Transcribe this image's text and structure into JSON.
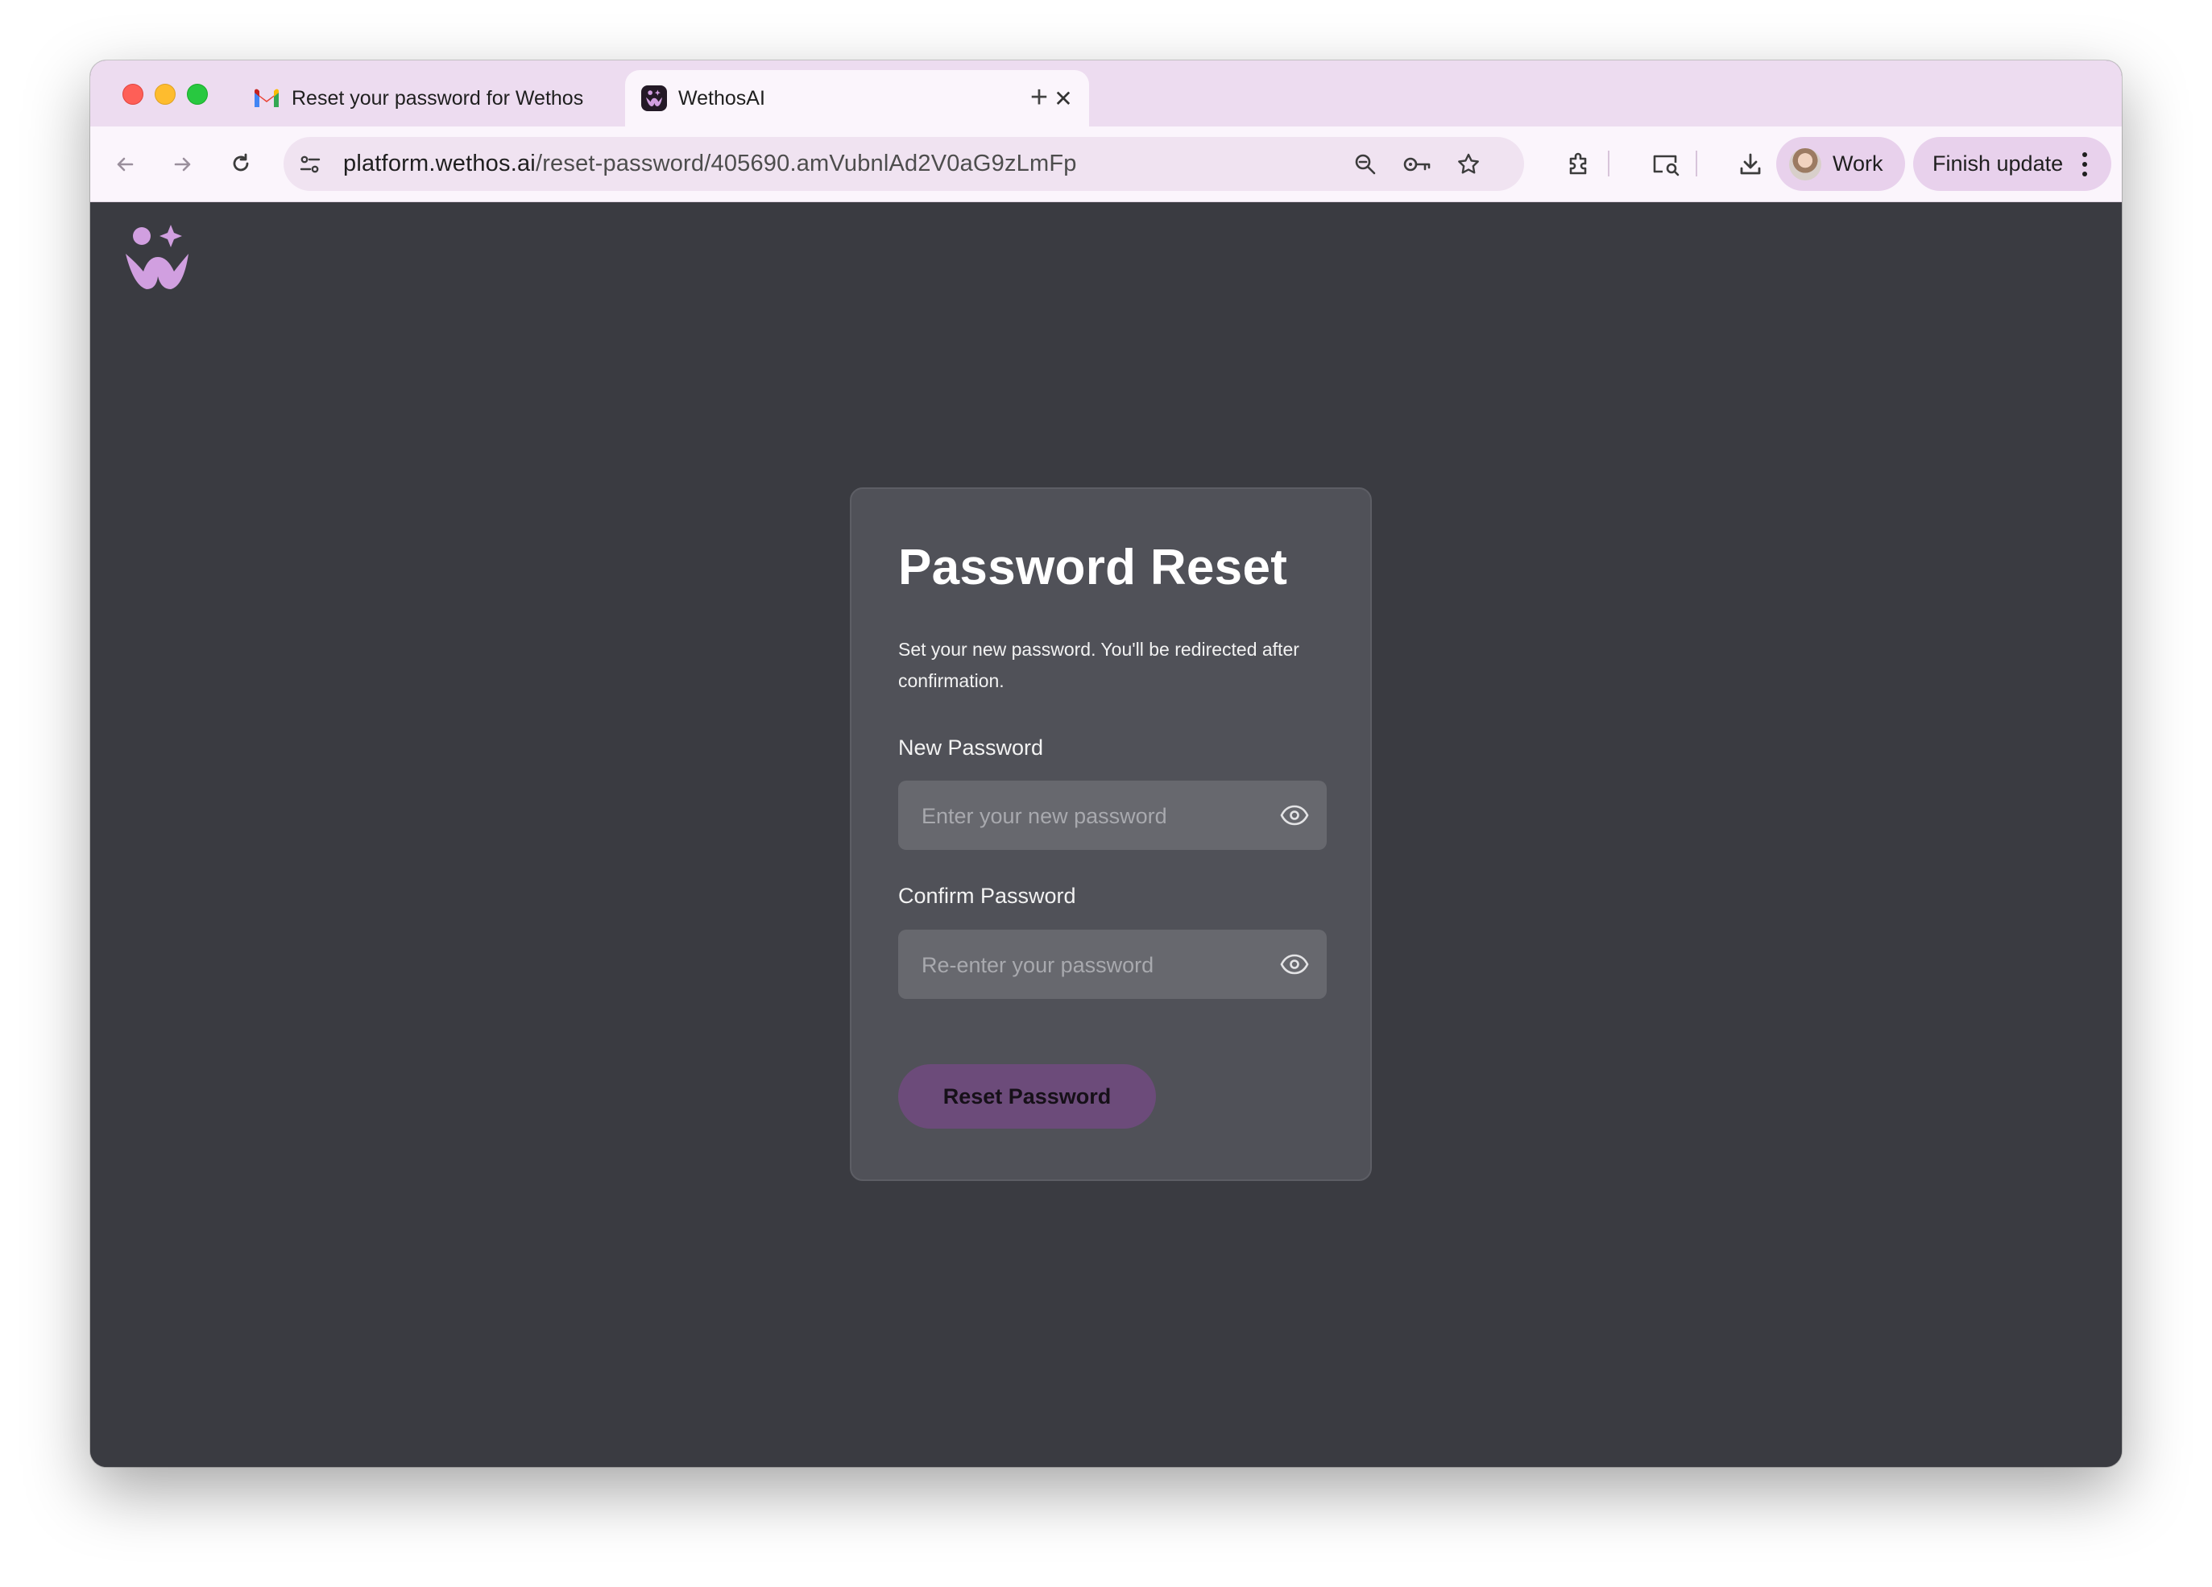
{
  "browser": {
    "tabs": [
      {
        "title": "Reset your password for Wethos",
        "favicon": "gmail-icon",
        "active": false
      },
      {
        "title": "WethosAI",
        "favicon": "wethos-icon",
        "active": true
      }
    ],
    "new_tab_label": "+",
    "close_glyph": "✕",
    "url_host": "platform.wethos.ai",
    "url_path": "/reset-password/405690.amVubnlAd2V0aG9zLmFp",
    "profile_label": "Work",
    "update_label": "Finish update"
  },
  "colors": {
    "accent": "#d19fe0",
    "page_bg": "#3a3b41",
    "card_bg": "#505158",
    "button_bg": "#6c4b7a"
  },
  "form": {
    "title": "Password Reset",
    "subtitle": "Set your new password. You'll be redirected after confirmation.",
    "new_password_label": "New Password",
    "new_password_placeholder": "Enter your new password",
    "new_password_value": "",
    "confirm_password_label": "Confirm Password",
    "confirm_password_placeholder": "Re-enter your password",
    "confirm_password_value": "",
    "submit_label": "Reset Password"
  }
}
